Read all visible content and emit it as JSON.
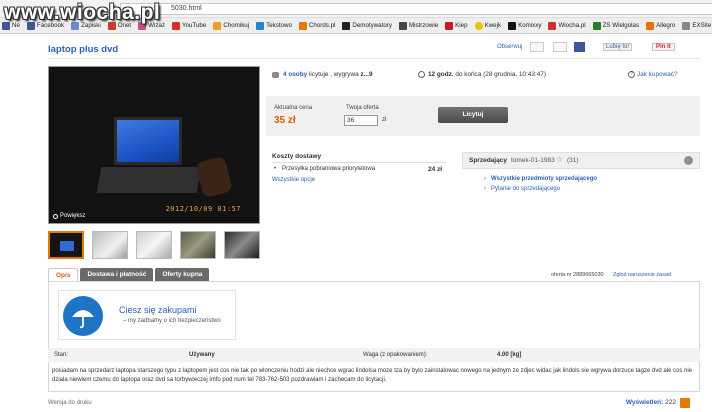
{
  "watermark": "www.wiocha.pl",
  "browser": {
    "url_fragment": "5030.html"
  },
  "bookmarks": [
    {
      "label": "Ne",
      "color": "#3b5998"
    },
    {
      "label": "Facebook",
      "color": "#3b5998"
    },
    {
      "label": "Zapiski",
      "color": "#6a8bd0"
    },
    {
      "label": "Onet",
      "color": "#d23b2b"
    },
    {
      "label": "Wizaż",
      "color": "#c84b8a"
    },
    {
      "label": "YouTube",
      "color": "#e02b2b"
    },
    {
      "label": "Chomikuj",
      "color": "#f0a020"
    },
    {
      "label": "Tekstowo",
      "color": "#2d7fd0"
    },
    {
      "label": "Chords.pl",
      "color": "#e07a00"
    },
    {
      "label": "Demotywatory",
      "color": "#222222"
    },
    {
      "label": "Mistrzowie",
      "color": "#444444"
    },
    {
      "label": "Kiep",
      "color": "#c02020"
    },
    {
      "label": "Kwejk",
      "color": "#f2c200"
    },
    {
      "label": "Komixxy",
      "color": "#111111"
    },
    {
      "label": "Wiocha.pl",
      "color": "#d03030"
    },
    {
      "label": "ZS Wielgolas",
      "color": "#2a7a2a"
    },
    {
      "label": "Allegro",
      "color": "#ff6a00"
    },
    {
      "label": "EXSite",
      "color": "#888888"
    }
  ],
  "page": {
    "title": "laptop plus dvd"
  },
  "share": {
    "observe": "Obserwuj",
    "like": "Lubię to!",
    "pin": "Pin it"
  },
  "photo": {
    "date_stamp": "2012/10/09 01:57",
    "zoom_label": "Powiększ"
  },
  "info": {
    "bidders": "4 osoby",
    "bidders_suffix": "licytuje , wygrywa",
    "winner": "z...9",
    "time_left": "12 godz.",
    "time_suffix": "do końca (28 grudnia, 10:43:47)",
    "how_to_buy": "Jak kupować?"
  },
  "price": {
    "current_label": "Aktualna cena",
    "current_value": "35 zł",
    "offer_label": "Twoja oferta",
    "offer_value": "36",
    "currency": "zł",
    "bid_button": "Licytuj"
  },
  "shipping": {
    "title": "Koszty dostawy",
    "method": "Przesyłka pobraniowa priorytetowa",
    "cost": "24 zł",
    "all_options": "Wszystkie opcje"
  },
  "seller": {
    "label": "Sprzedający",
    "name": "tomek-01-1983",
    "rating": "(31)",
    "all_items": "Wszystkie przedmioty sprzedającego",
    "ask": "Pytanie do sprzedającego"
  },
  "tabs": [
    {
      "label": "Opis"
    },
    {
      "label": "Dostawa i płatność"
    },
    {
      "label": "Oferty kupna"
    }
  ],
  "offer_meta": {
    "offer_number": "oferta nr 2889665030",
    "report": "Zgłoś naruszenie zasad"
  },
  "badge": {
    "title": "Ciesz się zakupami",
    "subtitle": "my zadbamy o ich bezpieczeństwo"
  },
  "attributes": {
    "state_label": "Stan:",
    "state_value": "Używany",
    "weight_label": "Waga (z opakowaniem):",
    "weight_value": "4.00 [kg]"
  },
  "description": "posiadam na sprzedarz laptopa starszego typu z laptopem jest cos nie tak po wlonczeniu hodzi ale niechce wgrac lindolsa moze tza by bylo zainstalowac nowego na jednym ze zdjec widac jak lindols sie wgrywa dorzuce tagze dvd ale cos nie dziala niewiem czemu do laptopa oraz dvd sa torbywieczej imfo pod num tel 783-762-503 pozdrawiam i zachecam do licytacji.",
  "footer": {
    "print_version": "Wersja do druku",
    "views_label": "Wyświetleń:",
    "views_value": "222"
  }
}
